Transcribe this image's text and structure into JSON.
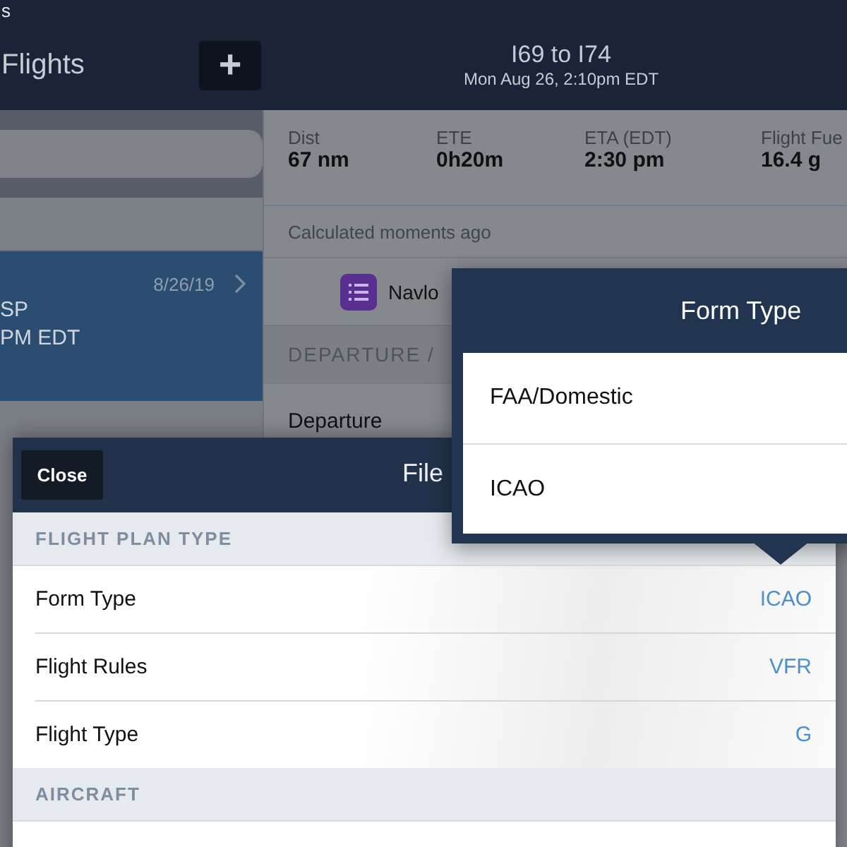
{
  "status_bar": {
    "text": "s"
  },
  "nav": {
    "title": "Flights",
    "add_button": "+",
    "route": "I69 to I74",
    "datetime": "Mon Aug 26, 2:10pm EDT"
  },
  "flight_list": {
    "items": [
      {
        "date": "8/26/19",
        "line_1": "SP",
        "line_2": "PM EDT",
        "selected": true
      }
    ]
  },
  "summary": {
    "stats": [
      {
        "label": "Dist",
        "value": "67 nm"
      },
      {
        "label": "ETE",
        "value": "0h20m"
      },
      {
        "label": "ETA (EDT)",
        "value": "2:30 pm"
      },
      {
        "label": "Flight Fue",
        "value": "16.4 g"
      }
    ],
    "calculated": "Calculated moments ago",
    "navlog_button": "Navlo",
    "departure_header": "DEPARTURE / ",
    "departure_label": "Departure"
  },
  "file_sheet": {
    "close_button": "Close",
    "title": "File",
    "sections": [
      {
        "header": "FLIGHT PLAN TYPE",
        "rows": [
          {
            "label": "Form Type",
            "value": "ICAO"
          },
          {
            "label": "Flight Rules",
            "value": "VFR"
          },
          {
            "label": "Flight Type",
            "value": "G"
          }
        ]
      },
      {
        "header": "AIRCRAFT"
      }
    ]
  },
  "form_type_popover": {
    "title": "Form Type",
    "options": [
      {
        "label": "FAA/Domestic"
      },
      {
        "label": "ICAO"
      }
    ]
  }
}
